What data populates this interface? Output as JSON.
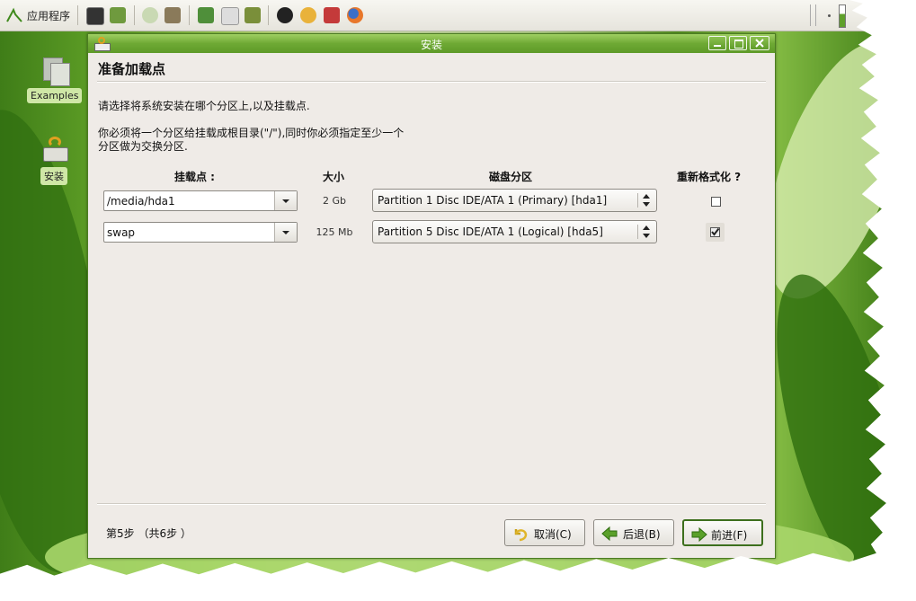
{
  "panel": {
    "apps_menu_label": "应用程序",
    "launchers": [
      "terminal-icon",
      "folder-icon",
      "music-icon",
      "cd-icon",
      "tools-icon",
      "editor-icon",
      "books-icon",
      "penguin-icon",
      "messenger-icon",
      "game-icon",
      "firefox-icon"
    ]
  },
  "desktop": {
    "icons": [
      {
        "label": "Examples",
        "icon": "examples-folder-icon"
      },
      {
        "label": "安装",
        "icon": "installer-icon"
      }
    ]
  },
  "window": {
    "title": "安装",
    "heading": "准备加载点",
    "intro": "请选择将系统安装在哪个分区上,以及挂载点.",
    "note_line1": "你必须将一个分区给挂载成根目录(\"/\"),同时你必须指定至少一个",
    "note_line2": "分区做为交换分区.",
    "columns": {
      "mount": "挂载点 :",
      "size": "大小",
      "partition": "磁盘分区",
      "reformat": "重新格式化 ?"
    },
    "rows": [
      {
        "mount": "/media/hda1",
        "size": "2 Gb",
        "partition": "Partition 1 Disc IDE/ATA 1 (Primary) [hda1]",
        "reformat": false
      },
      {
        "mount": "swap",
        "size": "125 Mb",
        "partition": "Partition 5 Disc IDE/ATA 1 (Logical) [hda5]",
        "reformat": true
      }
    ],
    "step": "第5步 （共6步 ）",
    "buttons": {
      "cancel": "取消(C)",
      "back": "后退(B)",
      "forward": "前进(F)"
    }
  },
  "colors": {
    "titlebar": "#6ea934",
    "window_bg": "#efebe7",
    "desktop_green": "#67a82a"
  }
}
